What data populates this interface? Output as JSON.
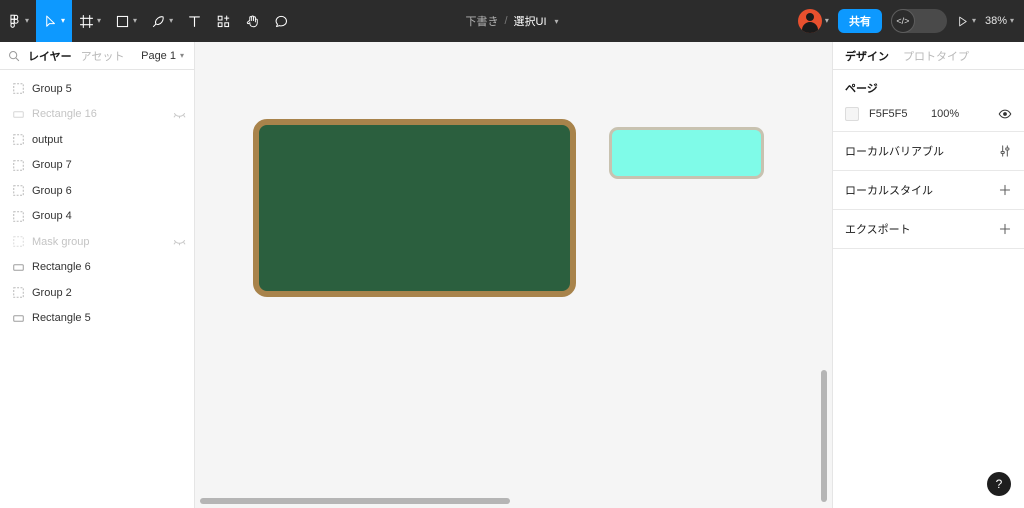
{
  "toolbar": {
    "tools": [
      {
        "name": "figma-menu-icon",
        "icon": "figma-logo",
        "has_caret": true,
        "active": false
      },
      {
        "name": "move-tool",
        "icon": "cursor",
        "has_caret": true,
        "active": true
      },
      {
        "name": "frame-tool",
        "icon": "frame",
        "has_caret": true,
        "active": false
      },
      {
        "name": "shape-tool",
        "icon": "rectangle",
        "has_caret": true,
        "active": false
      },
      {
        "name": "pen-tool",
        "icon": "pen",
        "has_caret": true,
        "active": false
      },
      {
        "name": "text-tool",
        "icon": "text",
        "has_caret": false,
        "active": false
      },
      {
        "name": "resources-tool",
        "icon": "components-plus",
        "has_caret": false,
        "active": false
      },
      {
        "name": "hand-tool",
        "icon": "hand",
        "has_caret": false,
        "active": false
      },
      {
        "name": "comment-tool",
        "icon": "comment",
        "has_caret": false,
        "active": false
      }
    ],
    "breadcrumb": {
      "parent": "下書き",
      "separator": "/",
      "current": "選択UI"
    },
    "share_label": "共有",
    "dev_mode_glyph": "</>",
    "zoom_level": "38%"
  },
  "left_panel": {
    "tabs": [
      {
        "label": "レイヤー",
        "active": true
      },
      {
        "label": "アセット",
        "active": false
      }
    ],
    "page_selector": "Page 1",
    "layers": [
      {
        "name": "Group 5",
        "type": "group",
        "hidden": false
      },
      {
        "name": "Rectangle 16",
        "type": "rectangle",
        "hidden": true
      },
      {
        "name": "output",
        "type": "group",
        "hidden": false
      },
      {
        "name": "Group 7",
        "type": "group",
        "hidden": false
      },
      {
        "name": "Group 6",
        "type": "group",
        "hidden": false
      },
      {
        "name": "Group 4",
        "type": "group",
        "hidden": false
      },
      {
        "name": "Mask group",
        "type": "group",
        "hidden": true
      },
      {
        "name": "Rectangle 6",
        "type": "rectangle",
        "hidden": false
      },
      {
        "name": "Group 2",
        "type": "group",
        "hidden": false
      },
      {
        "name": "Rectangle 5",
        "type": "rectangle",
        "hidden": false
      }
    ]
  },
  "canvas": {
    "background": "#F5F5F5",
    "nodes": [
      {
        "name": "chalkboard-rectangle",
        "fill": "#2B5F3E",
        "stroke": "#A8834B"
      },
      {
        "name": "cyan-rectangle",
        "fill": "#7FFBE8",
        "stroke": "#C8C2B0"
      }
    ]
  },
  "right_panel": {
    "tabs": [
      {
        "label": "デザイン",
        "active": true
      },
      {
        "label": "プロトタイプ",
        "active": false
      }
    ],
    "page_section": {
      "title": "ページ",
      "fill_hex": "F5F5F5",
      "fill_color": "#F5F5F5",
      "opacity": "100%"
    },
    "sections": [
      {
        "label": "ローカルバリアブル",
        "action": "sliders"
      },
      {
        "label": "ローカルスタイル",
        "action": "plus"
      },
      {
        "label": "エクスポート",
        "action": "plus"
      }
    ]
  },
  "help": {
    "glyph": "?"
  }
}
